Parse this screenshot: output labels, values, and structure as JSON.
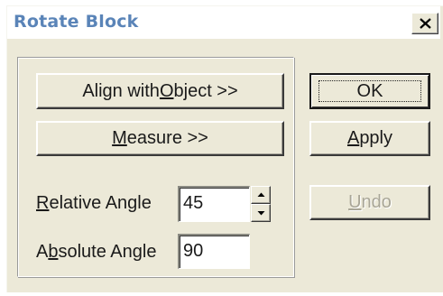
{
  "window": {
    "title": "Rotate Block",
    "close_icon": "close-x-icon"
  },
  "buttons": {
    "align_with_object": {
      "pre": "Align with ",
      "mnemonic": "O",
      "post": "bject >>"
    },
    "measure": {
      "pre": "",
      "mnemonic": "M",
      "post": "easure >>"
    },
    "ok": {
      "label": "OK"
    },
    "apply": {
      "pre": "",
      "mnemonic": "A",
      "post": "pply"
    },
    "undo": {
      "pre": "",
      "mnemonic": "U",
      "post": "ndo",
      "disabled": true
    }
  },
  "fields": {
    "relative_angle": {
      "label_pre": "",
      "label_mnemonic": "R",
      "label_post": "elative Angle",
      "value": "45"
    },
    "absolute_angle": {
      "label_pre": "A",
      "label_mnemonic": "b",
      "label_post": "solute Angle",
      "value": "90"
    }
  },
  "spinner": {
    "up_icon": "arrow-up-icon",
    "down_icon": "arrow-down-icon"
  },
  "colors": {
    "title_text": "#5a84b8",
    "dialog_face": "#ece9d8",
    "disabled_text": "#a9a697"
  }
}
